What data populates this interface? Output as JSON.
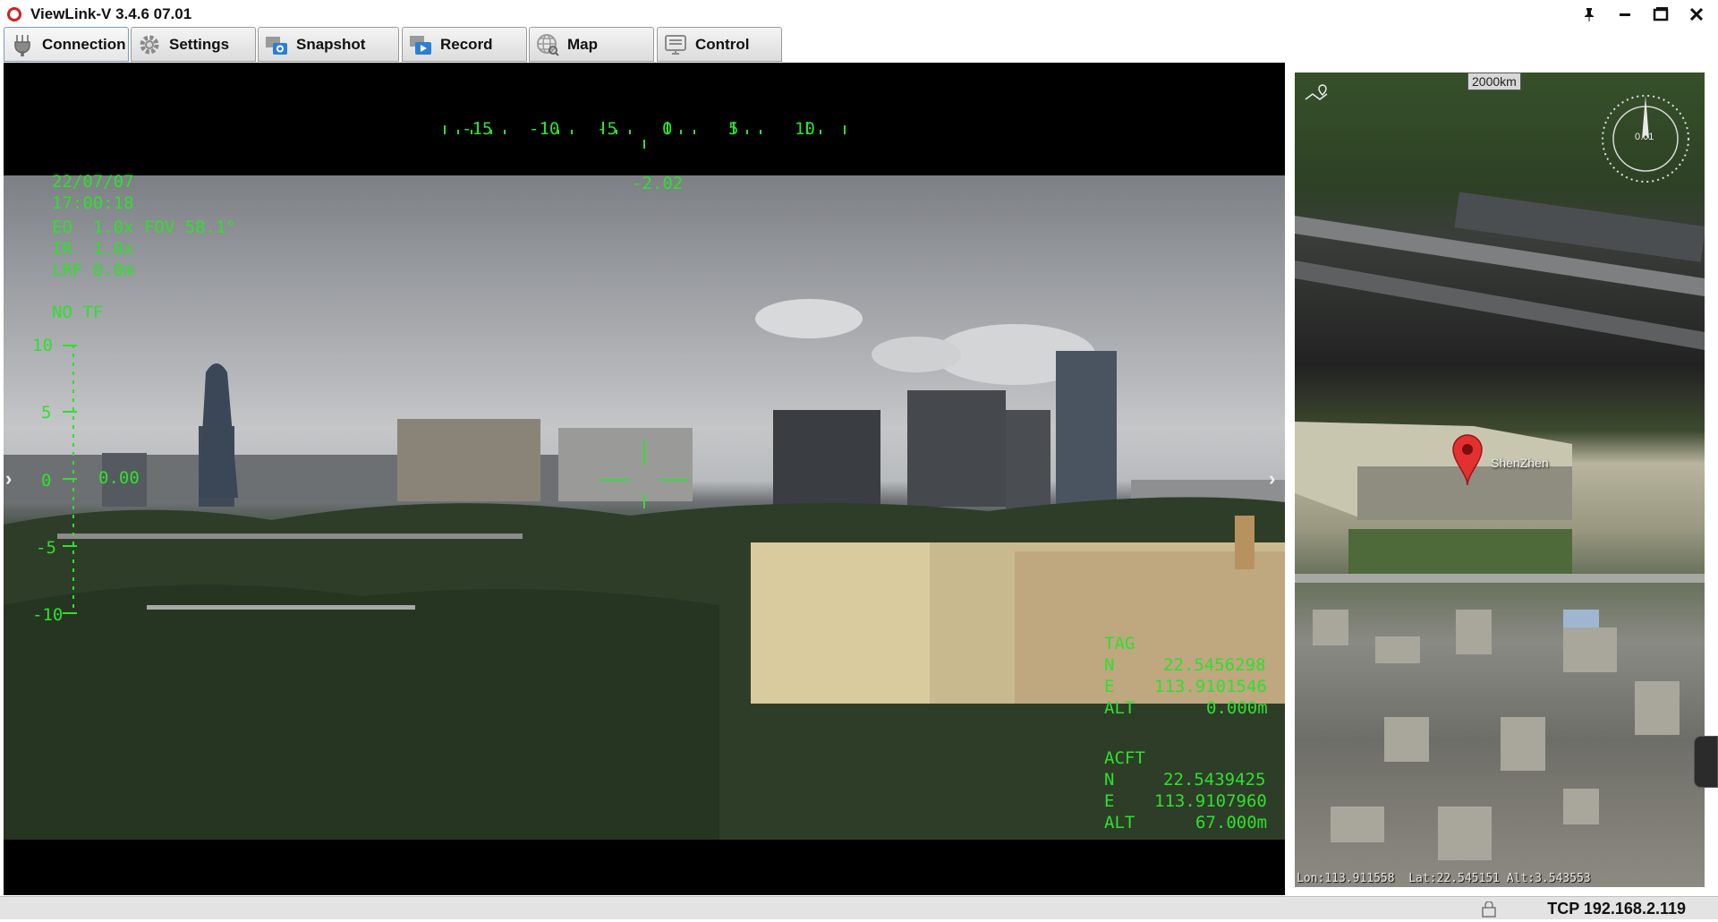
{
  "window": {
    "title": "ViewLink-V 3.4.6 07.01",
    "pin_icon": "pin-icon",
    "minimize_icon": "minimize-icon",
    "restore_icon": "restore-icon",
    "close_icon": "close-icon"
  },
  "tabs": [
    {
      "label": "Connection",
      "icon": "connection-icon"
    },
    {
      "label": "Settings",
      "icon": "gear-icon"
    },
    {
      "label": "Snapshot",
      "icon": "camera-icon"
    },
    {
      "label": "Record",
      "icon": "record-icon"
    },
    {
      "label": "Map",
      "icon": "globe-icon"
    },
    {
      "label": "Control",
      "icon": "monitor-icon"
    }
  ],
  "osd": {
    "heading_scale": [
      "-15",
      "-10",
      "-5",
      "0",
      "5",
      "10"
    ],
    "heading_value": "-2.02",
    "date": "22/07/07",
    "time": "17:00:18",
    "eo": "EO  1.0x FOV 58.1°",
    "ir": "IR  1.0x",
    "lrf": "LRF 0.0m",
    "tracking": "NO TF",
    "pitch_scale": [
      "10",
      "5",
      "0",
      "-5",
      "-10"
    ],
    "pitch_value": "0.00",
    "tag": {
      "label": "TAG",
      "n_label": "N",
      "n_value": "22.5456298",
      "e_label": "E",
      "e_value": "113.9101546",
      "alt_label": "ALT",
      "alt_value": "0.000m"
    },
    "acft": {
      "label": "ACFT",
      "n_label": "N",
      "n_value": "22.5439425",
      "e_label": "E",
      "e_value": "113.9107960",
      "alt_label": "ALT",
      "alt_value": "67.000m"
    }
  },
  "map": {
    "scale": "2000km",
    "compass_value": "0.01",
    "city_label": "ShenZhen",
    "coords": "Lon:113.911558  Lat:22.545151 Alt:3.543553"
  },
  "status": {
    "connection": "TCP 192.168.2.119"
  }
}
